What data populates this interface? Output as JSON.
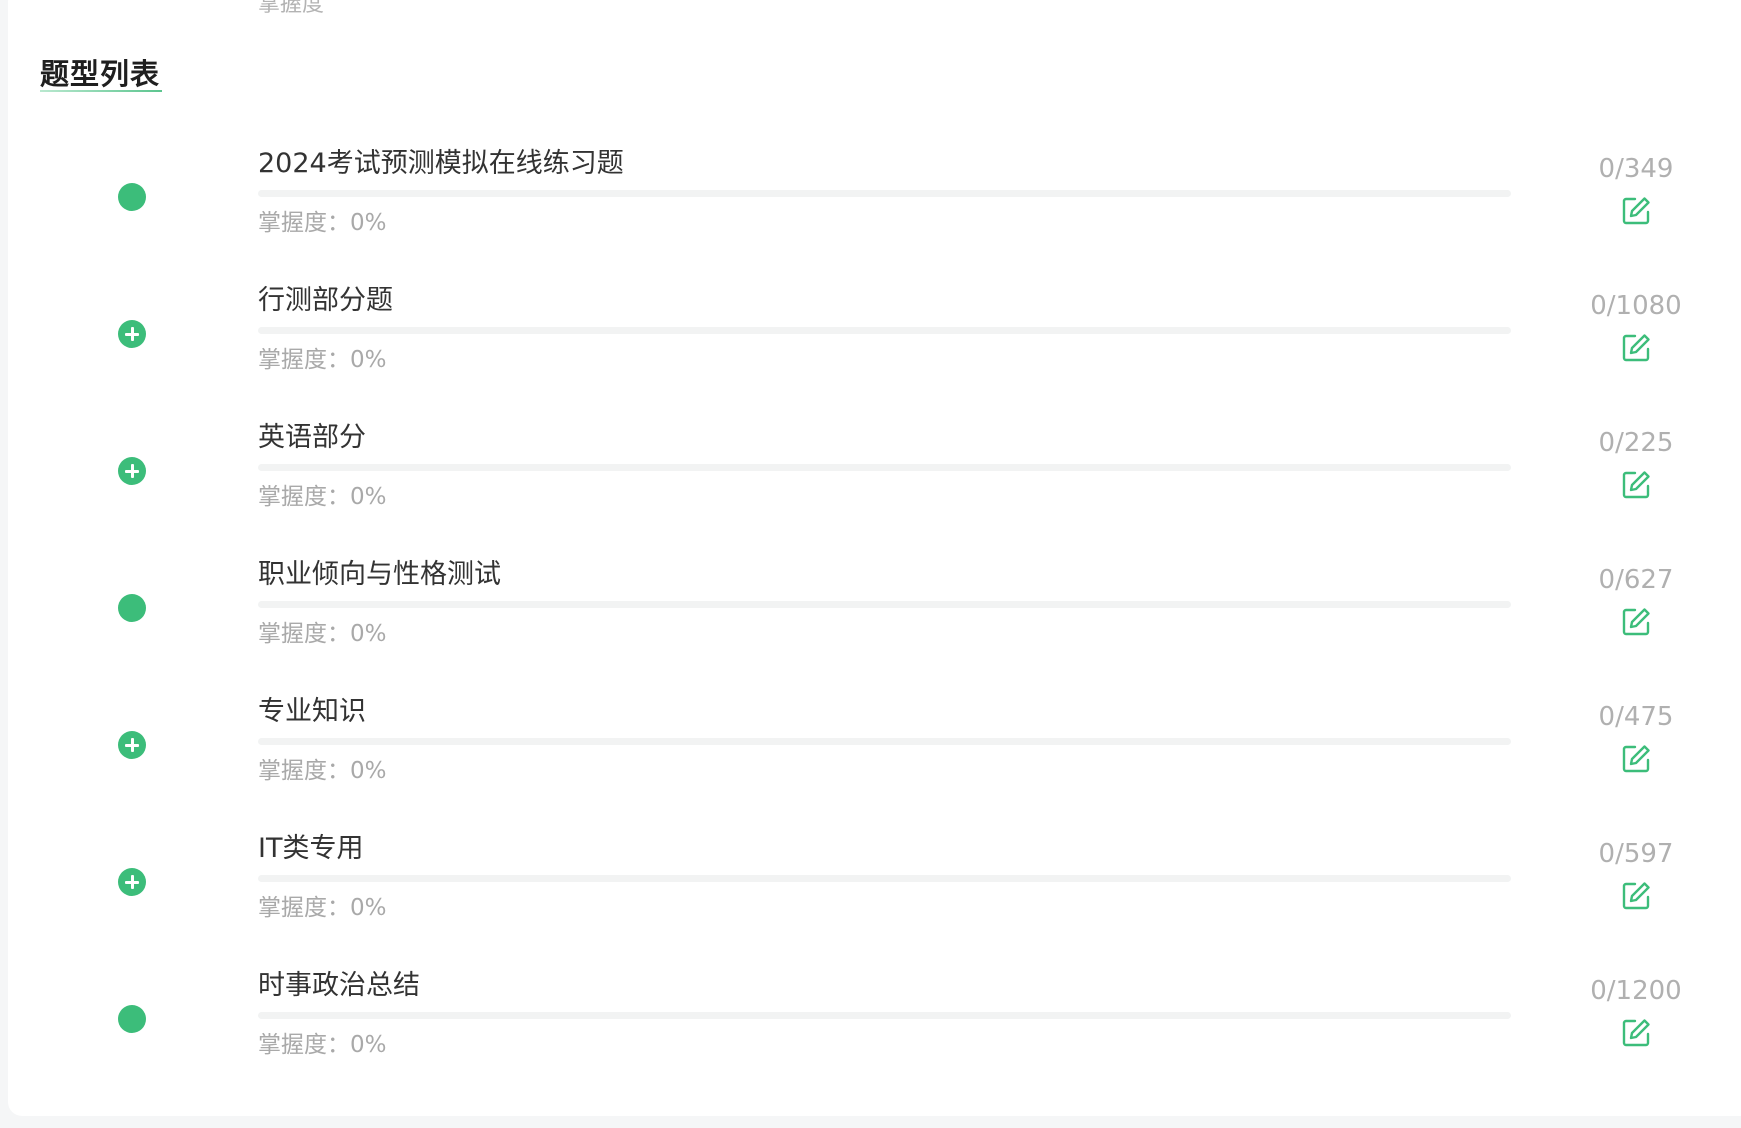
{
  "top_partial_text": "掌握度",
  "section": {
    "title": "题型列表"
  },
  "colors": {
    "accent": "#3cbd7a",
    "muted_text": "#a9a9a9",
    "track": "#f2f3f3"
  },
  "items": [
    {
      "title": "2024考试预测模拟在线练习题",
      "mastery_label": "掌握度：0%",
      "mastery_percent": 0,
      "count": "0/349",
      "marker": "dot-icon",
      "action_icon": "edit-icon"
    },
    {
      "title": "行测部分题",
      "mastery_label": "掌握度：0%",
      "mastery_percent": 0,
      "count": "0/1080",
      "marker": "plus-circle-icon",
      "action_icon": "edit-icon"
    },
    {
      "title": "英语部分",
      "mastery_label": "掌握度：0%",
      "mastery_percent": 0,
      "count": "0/225",
      "marker": "plus-circle-icon",
      "action_icon": "edit-icon"
    },
    {
      "title": "职业倾向与性格测试",
      "mastery_label": "掌握度：0%",
      "mastery_percent": 0,
      "count": "0/627",
      "marker": "dot-icon",
      "action_icon": "edit-icon"
    },
    {
      "title": "专业知识",
      "mastery_label": "掌握度：0%",
      "mastery_percent": 0,
      "count": "0/475",
      "marker": "plus-circle-icon",
      "action_icon": "edit-icon"
    },
    {
      "title": "IT类专用",
      "mastery_label": "掌握度：0%",
      "mastery_percent": 0,
      "count": "0/597",
      "marker": "plus-circle-icon",
      "action_icon": "edit-icon"
    },
    {
      "title": "时事政治总结",
      "mastery_label": "掌握度：0%",
      "mastery_percent": 0,
      "count": "0/1200",
      "marker": "dot-icon",
      "action_icon": "edit-icon"
    }
  ]
}
